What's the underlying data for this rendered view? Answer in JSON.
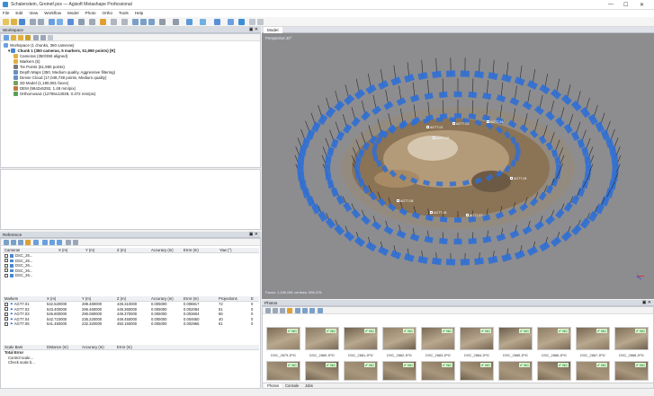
{
  "window": {
    "title": "Schalenstein, Greinef.psx — Agisoft Metashape Professional",
    "minimize": "—",
    "maximize": "☐",
    "close": "✕"
  },
  "menu": [
    "File",
    "Edit",
    "View",
    "Workflow",
    "Model",
    "Photo",
    "Ortho",
    "Tools",
    "Help"
  ],
  "workspace": {
    "title": "Workspace",
    "root": "Workspace (1 chunks, 350 cameras)",
    "chunk": "Chunk 1 (350 cameras, 5 markers, 51,990 points) [R]",
    "items": [
      {
        "label": "Cameras (350/350 aligned)",
        "icon": "folder-icon",
        "color": "#e0b040"
      },
      {
        "label": "Markers (5)",
        "icon": "folder-icon",
        "color": "#e0b040"
      },
      {
        "label": "Tie Points (51,990 points)",
        "icon": "points-icon",
        "color": "#7a7a7a"
      },
      {
        "label": "Depth Maps (350, Medium quality, Aggressive filtering)",
        "icon": "depth-icon",
        "color": "#6a8fc0"
      },
      {
        "label": "Dense Cloud (17,048,738 points, Medium quality)",
        "icon": "cloud-icon",
        "color": "#6a8fc0"
      },
      {
        "label": "3D Model (1,180,081 faces)",
        "icon": "mesh-icon",
        "color": "#7aa060"
      },
      {
        "label": "DEM (5942x5292, 1.48 mm/pix)",
        "icon": "dem-icon",
        "color": "#c07a40"
      },
      {
        "label": "Orthomosaic (12786x13028, 0.372 mm/pix)",
        "icon": "ortho-icon",
        "color": "#58a058"
      }
    ]
  },
  "reference": {
    "title": "Reference",
    "cameras_headers": [
      "Cameras",
      "X (m)",
      "Y (m)",
      "Z (m)",
      "Accuracy (m)",
      "Error (m)",
      "Yaw (°)"
    ],
    "cameras": [
      "DSC_26...",
      "DSC_26...",
      "DSC_26...",
      "DSC_26...",
      "DSC_26..."
    ],
    "markers_headers": [
      "Markers",
      "X (m)",
      "Y (m)",
      "Z (m)",
      "Accuracy (m)",
      "Error (m)",
      "Projections",
      "E"
    ],
    "markers": [
      {
        "name": "AGT7.01",
        "x": "542.520000",
        "y": "289.480000",
        "z": "449.310000",
        "acc": "0.005000",
        "err": "0.008817",
        "proj": "72",
        "e": "0"
      },
      {
        "name": "AGT7.02",
        "x": "543.400000",
        "y": "295.460000",
        "z": "449.360000",
        "acc": "0.005000",
        "err": "0.002084",
        "proj": "61",
        "e": "0"
      },
      {
        "name": "AGT7.03",
        "x": "545.800000",
        "y": "290.080000",
        "z": "449.370000",
        "acc": "0.005000",
        "err": "0.003604",
        "proj": "86",
        "e": "0"
      },
      {
        "name": "AGT7.04",
        "x": "542.710000",
        "y": "235.220000",
        "z": "449.450000",
        "acc": "0.005000",
        "err": "0.004650",
        "proj": "40",
        "e": "0"
      },
      {
        "name": "AGT7.05",
        "x": "541.450000",
        "y": "232.320000",
        "z": "450.150000",
        "acc": "0.005000",
        "err": "0.002965",
        "proj": "61",
        "e": "0"
      }
    ],
    "scalebar_headers": [
      "Scale Bars",
      "Distance (m)",
      "Accuracy (m)",
      "Error (m)"
    ],
    "scalebar_rows": [
      "Total Error",
      "Control scale...",
      "Check scale b..."
    ]
  },
  "model": {
    "tab": "Model",
    "perspective": "Perspective 30°",
    "status": "Faces: 1,180,081 vertices: 596,378",
    "markers": [
      "AGT7.01",
      "AGT7.02",
      "AGT7.03",
      "AGT7.04",
      "AGT7.05",
      "AGT7.06",
      "AGT7.07",
      "AGT7.08"
    ]
  },
  "photos": {
    "title": "Photos",
    "row1_labels": [
      "DSC_2879.JPG",
      "DSC_2880.JPG",
      "DSC_2881.JPG",
      "DSC_2882.JPG",
      "DSC_2883.JPG",
      "DSC_2884.JPG",
      "DSC_2885.JPG",
      "DSC_2886.JPG",
      "DSC_2887.JPG",
      "DSC_2888.JPG"
    ],
    "check": "✔ NC",
    "tabs": [
      "Photos",
      "Console",
      "Jobs"
    ]
  },
  "colors": {
    "camera_blue": "#2f6fd6",
    "viewport_bg": "#8d8d90",
    "accent": "#3a8fd8"
  }
}
